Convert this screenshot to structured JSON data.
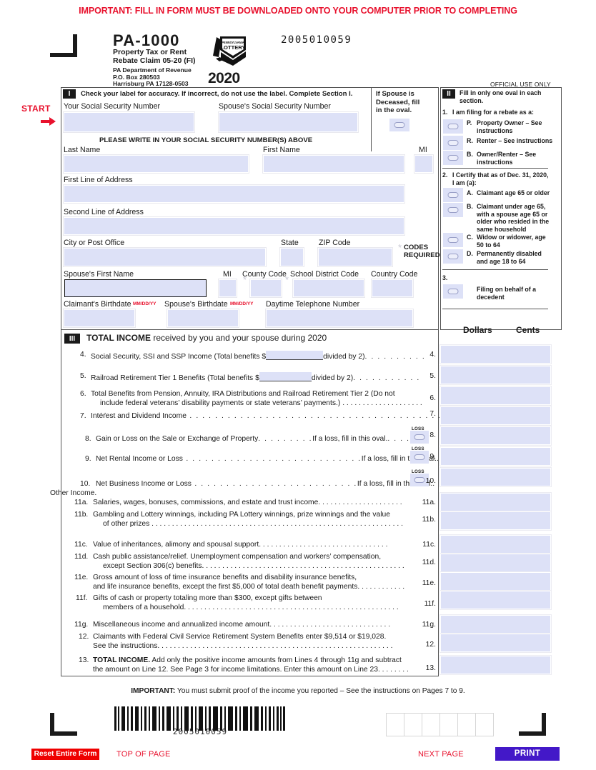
{
  "top_warning": "IMPORTANT: FILL IN FORM MUST BE DOWNLOADED ONTO YOUR COMPUTER PRIOR TO COMPLETING",
  "masthead": {
    "form_number": "PA-1000",
    "form_subtitle_line1": "Property Tax or Rent",
    "form_subtitle_line2": "Rebate Claim  05-20 (FI)",
    "agency_line1": "PA Department of Revenue",
    "agency_line2": "P.O. Box 280503",
    "agency_line3": "Harrisburg PA 17128-0503",
    "lottery_logo_top": "PENNSYLVANIA",
    "lottery_logo_main": "LOTTERY",
    "year": "2020",
    "doc_id": "2005010059",
    "official_use": "OFFICIAL USE ONLY"
  },
  "start": {
    "label": "START",
    "arrow": "→"
  },
  "section1": {
    "badge": "I",
    "instruction": "Check your label for accuracy. If incorrect, do not use the label. Complete Section I.",
    "ssn_label": "Your Social Security Number",
    "spouse_ssn_label": "Spouse's Social Security Number",
    "ssn_value": "",
    "spouse_ssn_value": "",
    "deceased_note_l1": "If Spouse is",
    "deceased_note_l2": "Deceased, fill",
    "deceased_note_l3": "in the oval.",
    "write_in_notice": "PLEASE WRITE IN YOUR SOCIAL SECURITY NUMBER(S) ABOVE",
    "last_name_label": "Last Name",
    "first_name_label": "First Name",
    "mi_label": "MI",
    "address1_label": "First Line of Address",
    "address2_label": "Second Line of Address",
    "city_label": "City or Post Office",
    "state_label": "State",
    "zip_label": "ZIP Code",
    "codes_required_l1": "CODES",
    "codes_required_l2": "REQUIRED",
    "spouse_first_name_label": "Spouse's First Name",
    "spouse_mi_label": "MI",
    "county_code_label": "County Code",
    "school_district_code_label": "School District Code",
    "country_code_label": "Country Code",
    "claimant_birthdate_label": "Claimant's Birthdate",
    "claimant_birthdate_fmt": "MM/DD/YY",
    "spouse_birthdate_label": "Spouse's Birthdate",
    "spouse_birthdate_fmt": "MM/DD/YY",
    "phone_label": "Daytime Telephone Number",
    "asterisk": "*"
  },
  "section2": {
    "badge": "II",
    "instruction_l1": "Fill in only one oval in each",
    "instruction_l2": "section.",
    "q1_number": "1.",
    "q1_text": "I am filing for a rebate as a:",
    "q1_options": [
      {
        "key": "P.",
        "text_l1": "Property Owner – See",
        "text_l2": "instructions"
      },
      {
        "key": "R.",
        "text_l1": "Renter – See instructions",
        "text_l2": ""
      },
      {
        "key": "B.",
        "text_l1": "Owner/Renter – See",
        "text_l2": "instructions"
      }
    ],
    "q2_number": "2.",
    "q2_text_l1": "I Certify that as of Dec. 31, 2020,",
    "q2_text_l2": "I am (a):",
    "q2_options": [
      {
        "key": "A.",
        "lines": [
          "Claimant age 65 or older"
        ]
      },
      {
        "key": "B.",
        "lines": [
          "Claimant under age 65,",
          "with a spouse age 65 or",
          "older who resided in the",
          "same household"
        ]
      },
      {
        "key": "C.",
        "lines": [
          "Widow or widower, age",
          "50 to 64"
        ]
      },
      {
        "key": "D.",
        "lines": [
          "Permanently disabled",
          "and age 18 to 64"
        ]
      }
    ],
    "q3_number": "3.",
    "q3_lines": [
      "Filing on behalf of a",
      "decedent"
    ],
    "dollars_header": "Dollars",
    "cents_header": "Cents"
  },
  "section3": {
    "badge": "III",
    "title_bold": "TOTAL INCOME",
    "title_rest": " received by you and your spouse during 2020",
    "loss_label": "LOSS",
    "lines": [
      {
        "no": "4.",
        "amt_no": "4.",
        "pre": "Social Security, SSI and SSP Income (Total benefits $",
        "post": "divided by 2)",
        "dots": ". . . . . . . . . .",
        "has_inline": true,
        "has_loss": false,
        "lines2": null
      },
      {
        "no": "5.",
        "amt_no": "5.",
        "pre": "Railroad Retirement Tier 1 Benefits (Total benefits $",
        "post": "divided by 2)",
        "dots": ". . . . . . . . . . .",
        "has_inline": true,
        "has_loss": false,
        "lines2": null
      },
      {
        "no": "6.",
        "amt_no": "6.",
        "pre": "Total Benefits from Pension, Annuity, IRA Distributions and Railroad Retirement Tier 2 (Do not",
        "post": "",
        "dots": "",
        "has_inline": false,
        "has_loss": false,
        "lines2": "include federal veterans’ disability payments or state veterans’ payments.) . . . . . . . . . . . . . . . . . . . . . ."
      },
      {
        "no": "7.",
        "amt_no": "7.",
        "pre": "Interest and Dividend Income",
        "post": "",
        "dots": " . . . . . . . . . . . . . . . . . . . . . . . . . . . . . . . . . . . . . . . . . . . . . . . . . .",
        "has_inline": false,
        "has_loss": false,
        "lines2": null
      },
      {
        "no": "8.",
        "amt_no": "8.",
        "pre": "Gain or Loss on the Sale or Exchange of Property",
        "post": "If a loss, fill in this oval.",
        "dots": ". . . .",
        "mid_dots": ". . . . . . . . .",
        "has_inline": false,
        "has_loss": true,
        "lines2": null
      },
      {
        "no": "9.",
        "amt_no": "9.",
        "pre": "Net Rental Income or Loss",
        "post": "If a loss, fill in this oval.",
        "dots": ". . . .",
        "mid_dots": " . . . . . . . . . . . . . . . . . . . . . . . . . . . .",
        "has_inline": false,
        "has_loss": true,
        "lines2": null
      },
      {
        "no": "10.",
        "amt_no": "10.",
        "pre": "Net Business Income or Loss",
        "post": "If a loss, fill in this oval.",
        "dots": ". . . .",
        "mid_dots": " . . . . . . . . . . . . . . . . . . . . . . . . . .",
        "has_inline": false,
        "has_loss": true,
        "lines2": null
      }
    ],
    "other_income_header": "Other Income.",
    "lines_b": [
      {
        "no": "11a.",
        "amt_no": "11a.",
        "l1": "Salaries, wages, bonuses, commissions, and estate and trust income.  . . . . . . . . . . . . . . . . . . . .",
        "l2": ""
      },
      {
        "no": "11b.",
        "amt_no": "11b.",
        "l1": "Gambling and Lottery winnings, including PA Lottery winnings, prize winnings and the value",
        "l2": "of other prizes . . . . . . . . . . . . . . . . . . . . . . . . . . . . . . . . . . . . . . . . . . . . . . . . . . . . . . . . . . . . . ."
      },
      {
        "no": "11c.",
        "amt_no": "11c.",
        "l1": "Value of inheritances, alimony and spousal support. . . . . . . . . . . . . . . . . . . . . . . . . . . . . . . .",
        "l2": ""
      },
      {
        "no": "11d.",
        "amt_no": "11d.",
        "l1": "Cash public assistance/relief. Unemployment compensation and workers’ compensation,",
        "l2": "except Section 306(c) benefits. . . . . . . . . . . . . . . . . . . . . . . . . . . . . . . . . . . . . . . . . . . . . . . . . ."
      },
      {
        "no": "11e.",
        "amt_no": "11e.",
        "l1": "Gross amount of loss of time insurance benefits and disability insurance benefits,",
        "l2": "and life insurance benefits, except the first $5,000 of total death benefit payments. . . . . . . . . . . ."
      },
      {
        "no": "11f.",
        "amt_no": "11f.",
        "l1": "Gifts of cash or property totaling more than $300, except gifts between",
        "l2": "members of a household. . . . . . . . . . . . . . . . . . . . . . . . . . . . . . . . . . . . . . . . . . . . . . . . . . . . ."
      },
      {
        "no": "11g.",
        "amt_no": "11g.",
        "l1": "Miscellaneous income and annualized income amount.  . . . . . . . . . . . . . . . . . . . . . . . . . . . . .",
        "l2": ""
      },
      {
        "no": "12.",
        "amt_no": "12.",
        "l1": "Claimants with Federal Civil Service Retirement System Benefits enter $9,514 or $19,028.",
        "l2": "See the instructions. . . . . . . . . . . . . . . . . . . . . . . . . . . . . . . . . . . . . . . . . . . . . . . . . . . . . . . . . ."
      },
      {
        "no": "13.",
        "amt_no": "13.",
        "bold_lead": "TOTAL INCOME.",
        "l1": " Add only the positive income amounts from Lines 4 through 11g and subtract",
        "l2": "the amount on Line 12. See Page 3 for income limitations. Enter this amount on Line 23. . . . . . . ."
      }
    ]
  },
  "footer": {
    "important_bold": "IMPORTANT:",
    "important_rest": " You must submit proof of the income you reported – See the instructions on Pages 7 to 9.",
    "barcode_number": "2005010059",
    "reset_button": "Reset Entire Form",
    "top_of_page_link": "TOP OF PAGE",
    "next_page_link": "NEXT PAGE",
    "print_button": "PRINT"
  },
  "colors": {
    "red": "#e8112d",
    "field_blue": "#dde1f7",
    "print_purple": "#4318c8",
    "reset_red": "#ef0000"
  }
}
